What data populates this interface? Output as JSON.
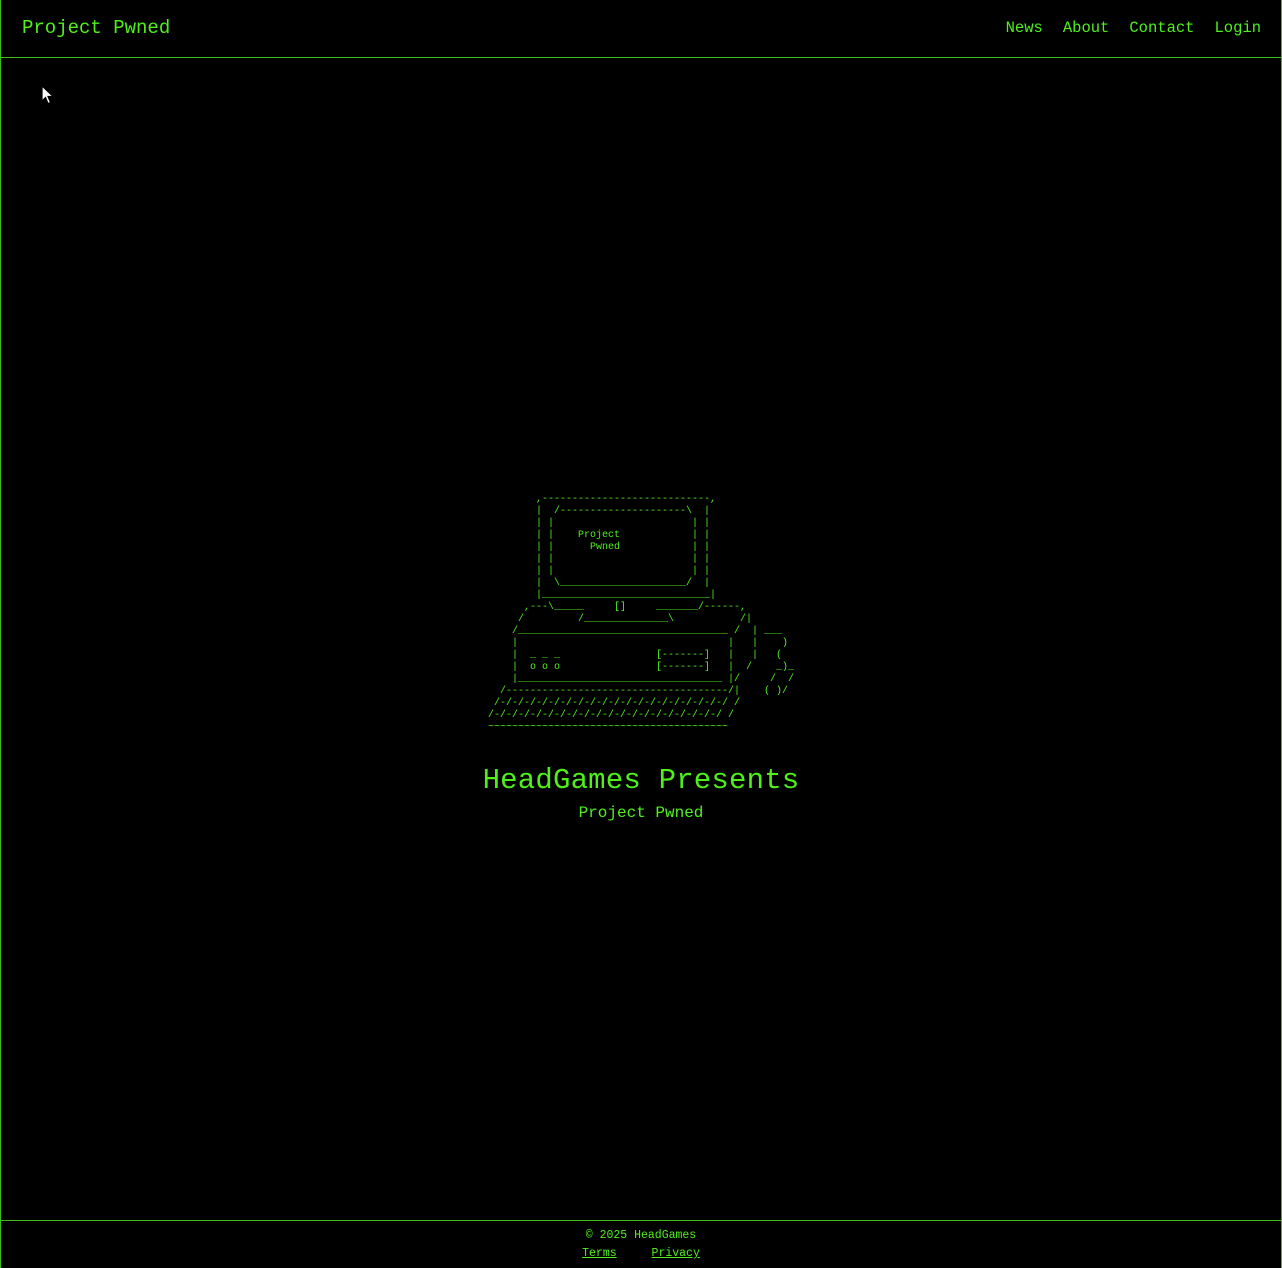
{
  "header": {
    "brand": "Project Pwned",
    "nav": [
      "News",
      "About",
      "Contact",
      "Login"
    ]
  },
  "hero": {
    "ascii_art": "        ,----------------------------,\n        |  /---------------------\\  |\n        | |                       | |\n        | |    Project            | |\n        | |      Pwned            | |\n        | |                       | |\n        | |                       | |\n        |  \\_____________________/  |\n        |____________________________|\n      ,---\\_____     []     _______/------,\n     /         /______________\\           /|\n    /___________________________________ /  | ___\n    |                                   |   |    )\n    |  _ _ _                [-------]   |   |   (\n    |  o o o                [-------]   |  /    _)_\n    |__________________________________ |/     /  /\n  /-------------------------------------/|    ( )/\n /-/-/-/-/-/-/-/-/-/-/-/-/-/-/-/-/-/-/-/ /\n/-/-/-/-/-/-/-/-/-/-/-/-/-/-/-/-/-/-/-/ /\n~~~~~~~~~~~~~~~~~~~~~~~~~~~~~~~~~~~~~~~~",
    "title": "HeadGames Presents",
    "subtitle": "Project Pwned"
  },
  "footer": {
    "copyright": "© 2025 HeadGames",
    "links": [
      "Terms",
      "Privacy"
    ]
  },
  "colors": {
    "background": "#000000",
    "accent": "#4ff01a",
    "border": "#3bbf14"
  }
}
